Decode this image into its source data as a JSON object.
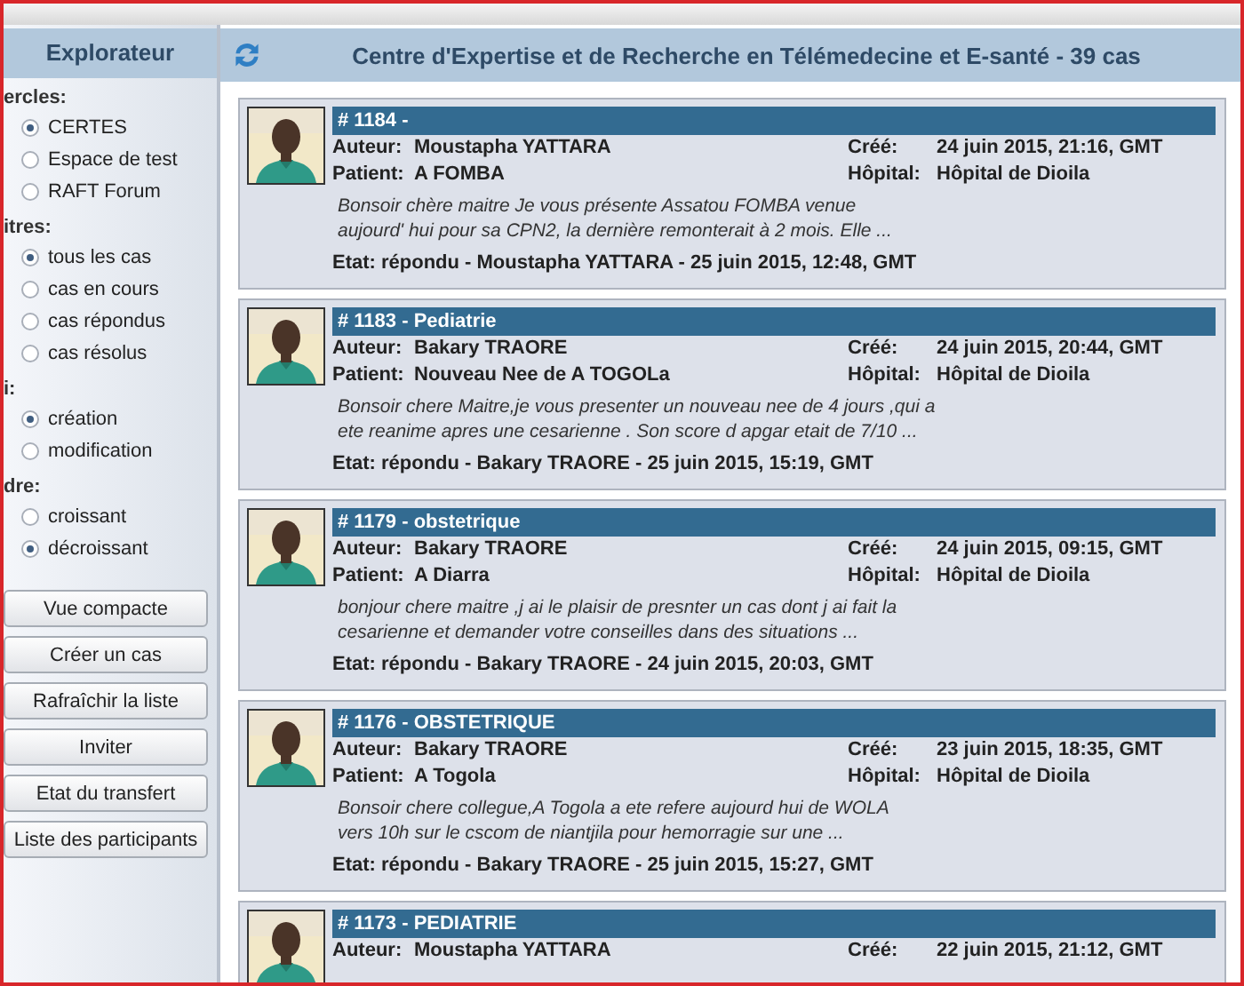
{
  "sidebar": {
    "title": "Explorateur",
    "groups": [
      {
        "label": "ercles:",
        "options": [
          {
            "label": "CERTES",
            "selected": true
          },
          {
            "label": "Espace de test",
            "selected": false
          },
          {
            "label": "RAFT Forum",
            "selected": false
          }
        ]
      },
      {
        "label": "itres:",
        "options": [
          {
            "label": "tous les cas",
            "selected": true
          },
          {
            "label": "cas en cours",
            "selected": false
          },
          {
            "label": "cas répondus",
            "selected": false
          },
          {
            "label": "cas résolus",
            "selected": false
          }
        ]
      },
      {
        "label": "i:",
        "options": [
          {
            "label": "création",
            "selected": true
          },
          {
            "label": "modification",
            "selected": false
          }
        ]
      },
      {
        "label": "dre:",
        "options": [
          {
            "label": "croissant",
            "selected": false
          },
          {
            "label": "décroissant",
            "selected": true
          }
        ]
      }
    ],
    "buttons": [
      "Vue compacte",
      "Créer un cas",
      "Rafraîchir la liste",
      "Inviter",
      "Etat du transfert",
      "Liste des participants"
    ]
  },
  "main": {
    "title": "Centre d'Expertise et de Recherche en Télémedecine et E-santé - 39 cas",
    "cases": [
      {
        "header": "# 1184 -",
        "author_label": "Auteur:",
        "author": "Moustapha YATTARA",
        "created_label": "Créé:",
        "created": "24 juin 2015, 21:16, GMT",
        "patient_label": "Patient:",
        "patient": "A FOMBA",
        "hospital_label": "Hôpital:",
        "hospital": "Hôpital de Dioila",
        "excerpt": [
          "Bonsoir chère maitre Je vous présente Assatou FOMBA venue",
          "aujourd' hui pour sa CPN2, la dernière remonterait à 2 mois. Elle  ..."
        ],
        "status": "Etat: répondu - Moustapha YATTARA - 25 juin 2015, 12:48, GMT"
      },
      {
        "header": "# 1183 - Pediatrie",
        "author_label": "Auteur:",
        "author": "Bakary TRAORE",
        "created_label": "Créé:",
        "created": "24 juin 2015, 20:44, GMT",
        "patient_label": "Patient:",
        "patient": "Nouveau Nee de A TOGOLa",
        "hospital_label": "Hôpital:",
        "hospital": "Hôpital de Dioila",
        "excerpt": [
          "Bonsoir chere Maitre,je vous presenter un nouveau nee de 4 jours ,qui a",
          "ete reanime apres une cesarienne . Son score d apgar etait de 7/10  ..."
        ],
        "status": "Etat: répondu - Bakary TRAORE - 25 juin 2015, 15:19, GMT"
      },
      {
        "header": "# 1179 - obstetrique",
        "author_label": "Auteur:",
        "author": "Bakary TRAORE",
        "created_label": "Créé:",
        "created": "24 juin 2015, 09:15, GMT",
        "patient_label": "Patient:",
        "patient": "A Diarra",
        "hospital_label": "Hôpital:",
        "hospital": "Hôpital de Dioila",
        "excerpt": [
          "bonjour chere maitre ,j ai le plaisir de presnter un cas dont j ai fait la",
          "cesarienne et demander votre conseilles dans des situations  ..."
        ],
        "status": "Etat: répondu - Bakary TRAORE - 24 juin 2015, 20:03, GMT"
      },
      {
        "header": "# 1176 - OBSTETRIQUE",
        "author_label": "Auteur:",
        "author": "Bakary TRAORE",
        "created_label": "Créé:",
        "created": "23 juin 2015, 18:35, GMT",
        "patient_label": "Patient:",
        "patient": "A Togola",
        "hospital_label": "Hôpital:",
        "hospital": "Hôpital de Dioila",
        "excerpt": [
          "Bonsoir chere collegue,A Togola a ete refere aujourd hui de WOLA",
          "vers 10h sur le cscom de niantjila pour hemorragie sur une  ..."
        ],
        "status": "Etat: répondu - Bakary TRAORE - 25 juin 2015, 15:27, GMT"
      },
      {
        "header": "# 1173 - PEDIATRIE",
        "author_label": "Auteur:",
        "author": "Moustapha YATTARA",
        "created_label": "Créé:",
        "created": "22 juin 2015, 21:12, GMT"
      }
    ]
  }
}
